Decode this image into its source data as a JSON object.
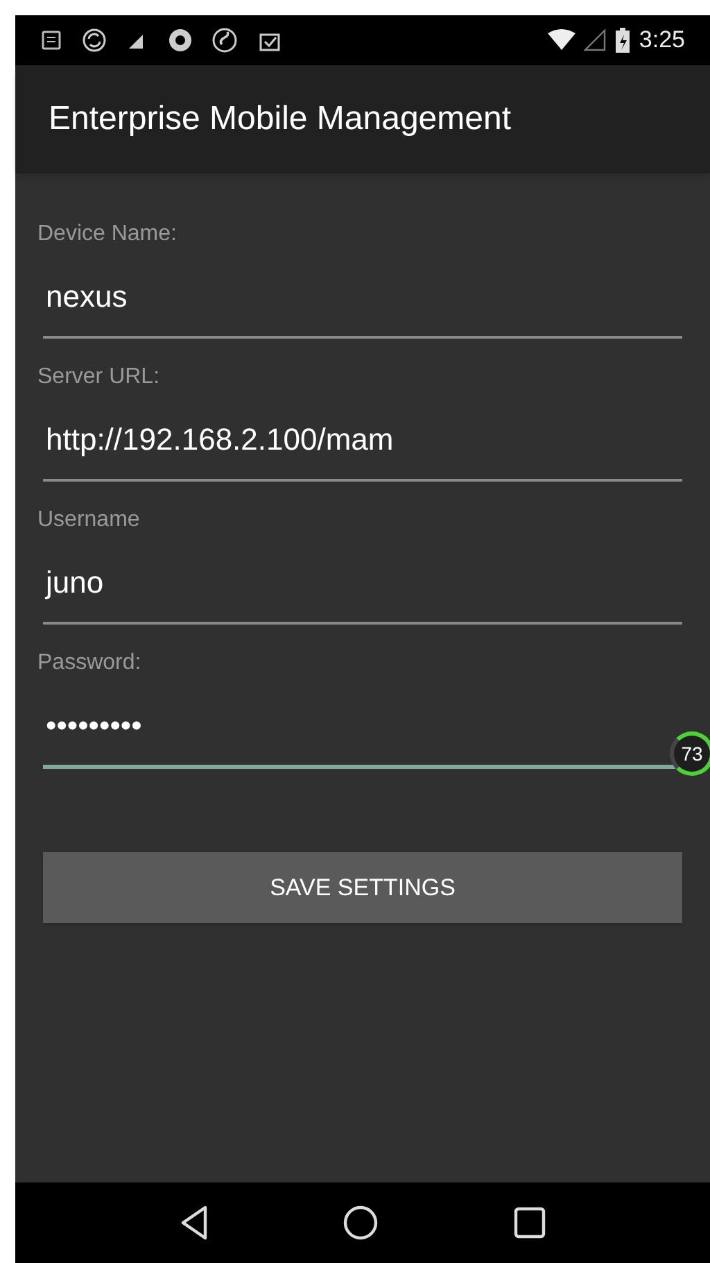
{
  "status_bar": {
    "time": "3:25"
  },
  "app_bar": {
    "title": "Enterprise Mobile Management"
  },
  "fields": [
    {
      "label": "Device Name:",
      "value": "nexus",
      "focused": false
    },
    {
      "label": "Server URL:",
      "value": "http://192.168.2.100/mam",
      "focused": false
    },
    {
      "label": "Username",
      "value": "juno",
      "focused": false
    },
    {
      "label": "Password:",
      "value": "•••••••••",
      "focused": true
    }
  ],
  "save_button": {
    "label": "SAVE SETTINGS"
  },
  "overlay_badge": {
    "text": "73"
  }
}
